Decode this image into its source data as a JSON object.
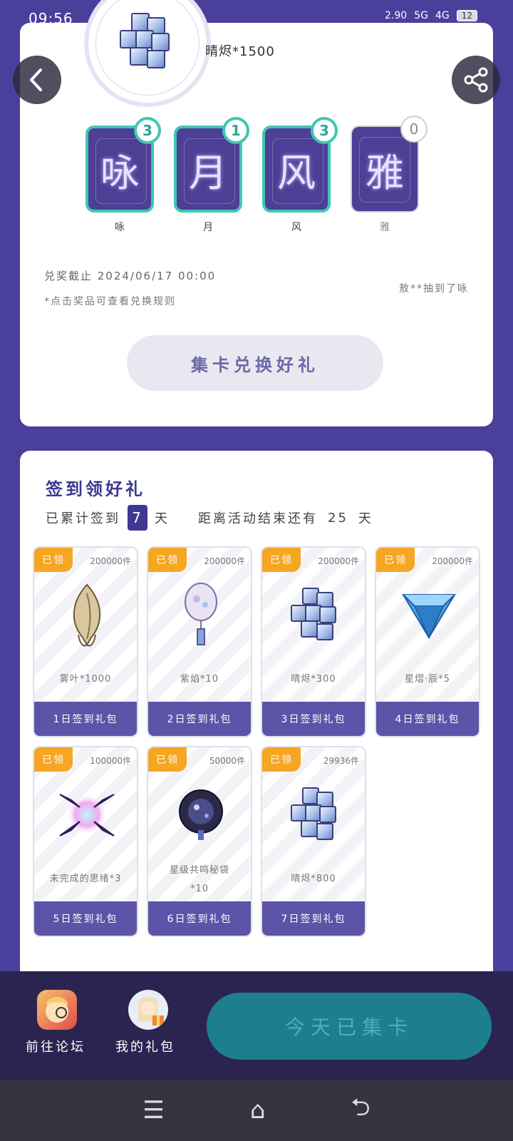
{
  "status": {
    "time": "09:56",
    "speed": "2.90",
    "network1": "5G",
    "network2": "4G",
    "battery": "12"
  },
  "header": {
    "balance": "晴烬*1500"
  },
  "characters": [
    {
      "glyph": "咏",
      "label": "咏",
      "count": "3"
    },
    {
      "glyph": "月",
      "label": "月",
      "count": "1"
    },
    {
      "glyph": "风",
      "label": "风",
      "count": "3"
    },
    {
      "glyph": "雅",
      "label": "雅",
      "count": "0"
    }
  ],
  "info": {
    "deadline": "兑奖截止 2024/06/17 00:00",
    "rule_hint": "*点击奖品可查看兑换规则",
    "ticker": "敖**抽到了咏",
    "exchange_button": "集卡兑换好礼"
  },
  "signin": {
    "title": "签到领好礼",
    "prefix": "已累计签到",
    "days": "7",
    "day_unit": "天",
    "remaining_text": "距离活动结束还有",
    "remaining_days": "25",
    "remaining_unit": "天",
    "gifts": [
      {
        "tag": "已领",
        "qty": "200000件",
        "name": "雾叶*1000",
        "footer": "1日签到礼包",
        "art": "leaf"
      },
      {
        "tag": "已领",
        "qty": "200000件",
        "name": "紫焰*10",
        "footer": "2日签到礼包",
        "art": "fan"
      },
      {
        "tag": "已领",
        "qty": "200000件",
        "name": "晴烬*300",
        "footer": "3日签到礼包",
        "art": "crystal"
      },
      {
        "tag": "已领",
        "qty": "200000件",
        "name": "星熠·辰*5",
        "footer": "4日签到礼包",
        "art": "gem"
      },
      {
        "tag": "已领",
        "qty": "100000件",
        "name": "未完成的思绪*3",
        "footer": "5日签到礼包",
        "art": "orb"
      },
      {
        "tag": "已领",
        "qty": "50000件",
        "name": "星级共鸣秘袋*10",
        "footer": "6日签到礼包",
        "art": "bag"
      },
      {
        "tag": "已领",
        "qty": "29936件",
        "name": "晴烬*800",
        "footer": "7日签到礼包",
        "art": "crystal"
      }
    ]
  },
  "bottom": {
    "forum_label": "前往论坛",
    "gifts_label": "我的礼包",
    "collect_button": "今天已集卡"
  },
  "colors": {
    "background": "#4a3f9b",
    "accent": "#3e3890",
    "teal": "#3fc7b4",
    "tag": "#f5a623"
  }
}
